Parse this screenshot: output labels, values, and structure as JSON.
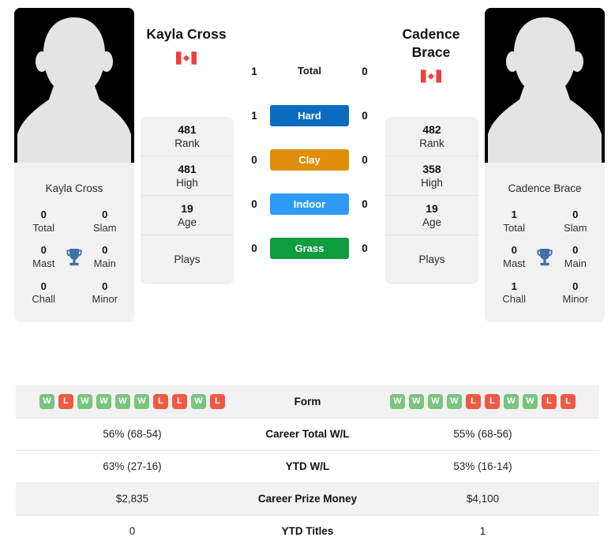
{
  "players": {
    "left": {
      "name": "Kayla Cross",
      "name_line1": "Kayla Cross",
      "flag": "canada-flag",
      "rank": "481",
      "rank_label": "Rank",
      "high": "481",
      "high_label": "High",
      "age": "19",
      "age_label": "Age",
      "plays_label": "Plays",
      "plays_value": "",
      "titles": {
        "total": "0",
        "total_label": "Total",
        "slam": "0",
        "slam_label": "Slam",
        "mast": "0",
        "mast_label": "Mast",
        "main": "0",
        "main_label": "Main",
        "chall": "0",
        "chall_label": "Chall",
        "minor": "0",
        "minor_label": "Minor"
      },
      "form": [
        "W",
        "L",
        "W",
        "W",
        "W",
        "W",
        "L",
        "L",
        "W",
        "L"
      ],
      "career_wl": "56% (68-54)",
      "ytd_wl": "63% (27-16)",
      "career_prize": "$2,835",
      "ytd_titles": "0"
    },
    "right": {
      "name": "Cadence Brace",
      "name_line1": "Cadence",
      "name_line2": "Brace",
      "flag": "canada-flag",
      "rank": "482",
      "rank_label": "Rank",
      "high": "358",
      "high_label": "High",
      "age": "19",
      "age_label": "Age",
      "plays_label": "Plays",
      "plays_value": "",
      "titles": {
        "total": "1",
        "total_label": "Total",
        "slam": "0",
        "slam_label": "Slam",
        "mast": "0",
        "mast_label": "Mast",
        "main": "0",
        "main_label": "Main",
        "chall": "1",
        "chall_label": "Chall",
        "minor": "0",
        "minor_label": "Minor"
      },
      "form": [
        "W",
        "W",
        "W",
        "W",
        "L",
        "L",
        "W",
        "W",
        "L",
        "L"
      ],
      "career_wl": "55% (68-56)",
      "ytd_wl": "53% (16-14)",
      "career_prize": "$4,100",
      "ytd_titles": "1"
    }
  },
  "head_to_head": {
    "rows": [
      {
        "label": "Total",
        "left": "1",
        "right": "0",
        "color": "",
        "type": "plain"
      },
      {
        "label": "Hard",
        "left": "1",
        "right": "0",
        "color": "#0b6cbf",
        "type": "badge"
      },
      {
        "label": "Clay",
        "left": "0",
        "right": "0",
        "color": "#e08e0b",
        "type": "badge"
      },
      {
        "label": "Indoor",
        "left": "0",
        "right": "0",
        "color": "#2e9bf5",
        "type": "badge"
      },
      {
        "label": "Grass",
        "left": "0",
        "right": "0",
        "color": "#0f9d3f",
        "type": "badge"
      }
    ]
  },
  "stats_rows": [
    {
      "label": "Form",
      "key": "form",
      "type": "form"
    },
    {
      "label": "Career Total W/L",
      "key": "career_wl",
      "type": "text"
    },
    {
      "label": "YTD W/L",
      "key": "ytd_wl",
      "type": "text"
    },
    {
      "label": "Career Prize Money",
      "key": "career_prize",
      "type": "text"
    },
    {
      "label": "YTD Titles",
      "key": "ytd_titles",
      "type": "text"
    }
  ],
  "colors": {
    "win": "#7ac47f",
    "loss": "#ef5a45",
    "hard": "#0b6cbf",
    "clay": "#e08e0b",
    "indoor": "#2e9bf5",
    "grass": "#0f9d3f",
    "trophy": "#4270a8",
    "panel": "#f1f1f1",
    "stripe": "#f2f2f2"
  }
}
